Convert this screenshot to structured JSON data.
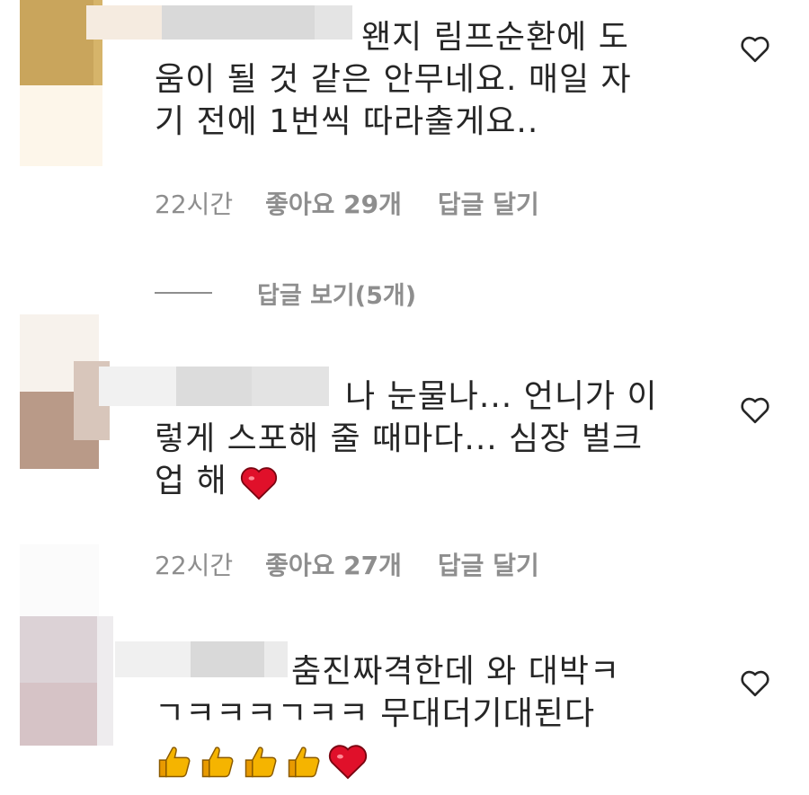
{
  "comments": [
    {
      "text": "왠지 림프순환에 도\n움이 될 것 같은 안무네요. 매일 자\n기 전에 1번씩 따라출게요..",
      "time": "22시간",
      "likes": "좋아요 29개",
      "reply": "답글 달기"
    },
    {
      "text": "나 눈물나... 언니가 이\n렇게 스포해 줄 때마다... 심장 벌크\n업 해 ",
      "time": "22시간",
      "likes": "좋아요 27개",
      "reply": "답글 달기",
      "emoji": [
        "red-heart"
      ]
    },
    {
      "text": "춤진짜격한데 와 대박ㅋ\nㄱㅋㅋㅋㄱㅋㅋ 무대더기대된다",
      "emoji": [
        "thumbs-up",
        "thumbs-up",
        "thumbs-up",
        "thumbs-up",
        "red-heart"
      ]
    }
  ],
  "view_replies": "답글 보기(5개)",
  "icons": {
    "like": "heart-outline-icon"
  },
  "colors": {
    "text": "#262626",
    "meta": "#8e8e8e",
    "heart": "#e0102a",
    "thumb": "#f5b400"
  }
}
